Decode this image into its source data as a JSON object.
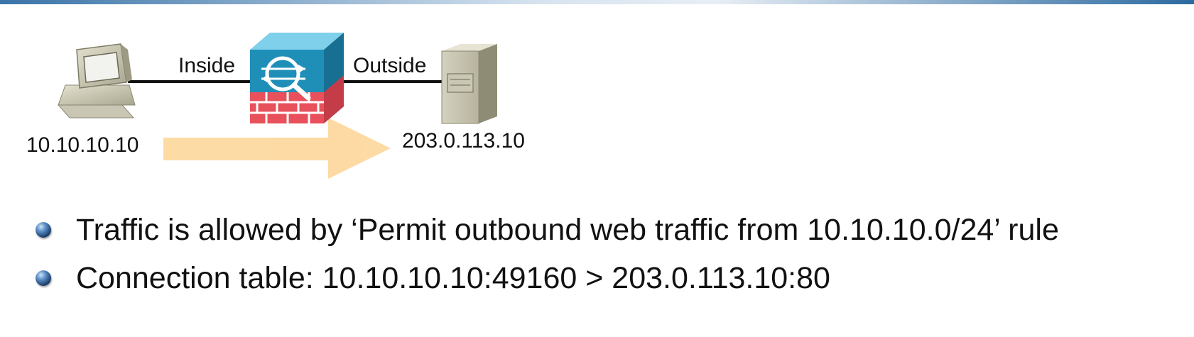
{
  "diagram": {
    "labels": {
      "inside": "Inside",
      "outside": "Outside",
      "client_ip": "10.10.10.10",
      "server_ip": "203.0.113.10"
    },
    "icons": {
      "client": "desktop-computer-icon",
      "firewall": "firewall-icon",
      "server": "server-icon",
      "flow": "traffic-arrow-icon"
    },
    "colors": {
      "firewall_blue": "#1f8fb8",
      "firewall_brick": "#e8505b",
      "arrow": "#fdd79a"
    }
  },
  "bullets": [
    "Traffic is allowed by ‘Permit outbound web traffic from 10.10.10.0/24’ rule",
    "Connection table: 10.10.10.10:49160 > 203.0.113.10:80"
  ]
}
